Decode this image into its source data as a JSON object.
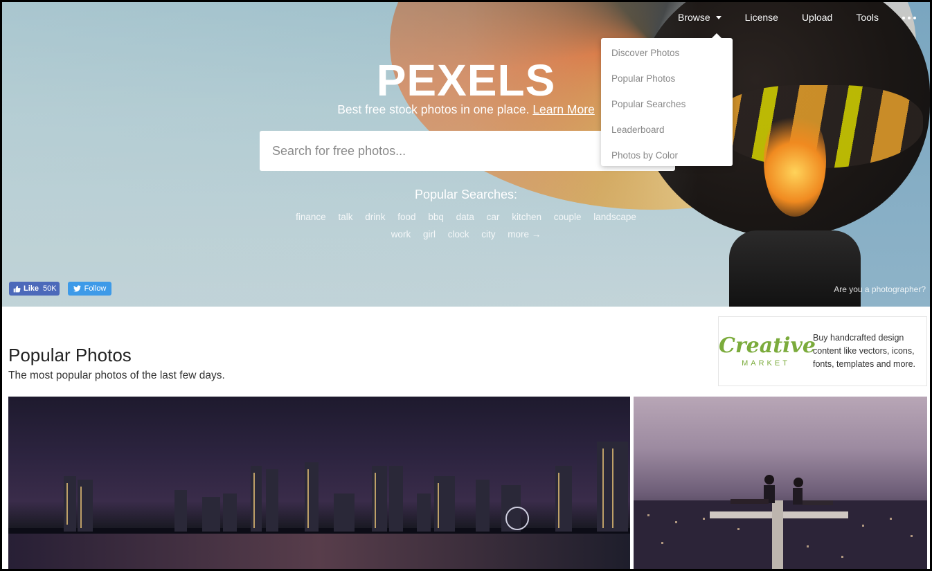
{
  "nav": {
    "browse": "Browse",
    "license": "License",
    "upload": "Upload",
    "tools": "Tools"
  },
  "browse_menu": {
    "items": [
      "Discover Photos",
      "Popular Photos",
      "Popular Searches",
      "Leaderboard",
      "Photos by Color"
    ]
  },
  "hero": {
    "logo": "PEXELS",
    "tagline": "Best free stock photos in one place.",
    "learn_more": "Learn More",
    "search_placeholder": "Search for free photos...",
    "popular_searches_title": "Popular Searches:",
    "tags_row1": [
      "finance",
      "talk",
      "drink",
      "food",
      "bbq",
      "data",
      "car",
      "kitchen",
      "couple",
      "landscape"
    ],
    "tags_row2": [
      "work",
      "girl",
      "clock",
      "city",
      "more →"
    ]
  },
  "social": {
    "fb_like": "Like",
    "fb_count": "50K",
    "tw_follow": "Follow"
  },
  "photographer_link": "Are you a photographer?",
  "section": {
    "title": "Popular Photos",
    "subtitle": "The most popular photos of the last few days."
  },
  "ad": {
    "logo_script": "Creative",
    "logo_market": "MARKET",
    "text": "Buy handcrafted design content like vectors, icons, fonts, templates and more."
  }
}
